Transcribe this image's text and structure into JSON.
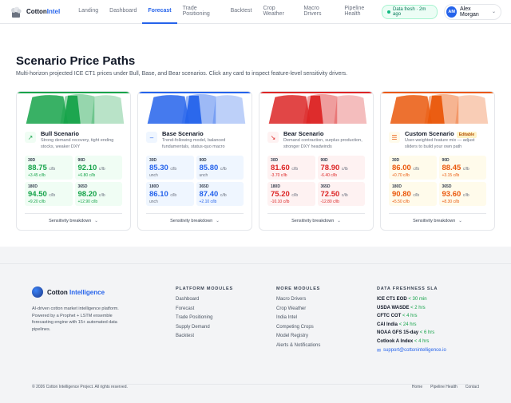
{
  "brand": {
    "name_a": "Cotton",
    "name_b": "Intel"
  },
  "nav": {
    "items": [
      "Landing",
      "Dashboard",
      "Forecast",
      "Trade Positioning",
      "Backtest",
      "Crop Weather",
      "Macro Drivers",
      "Pipeline Health"
    ],
    "active": "Forecast",
    "fresh": "Data fresh · 2m ago",
    "user_initials": "AM",
    "user_name": "Alex Morgan"
  },
  "page": {
    "title": "Scenario Price Paths",
    "subtitle": "Multi-horizon projected ICE CT1 prices under Bull, Base, and Bear scenarios. Click any card to inspect feature-level sensitivity drivers."
  },
  "cards": [
    {
      "title": "Bull Scenario",
      "desc": "Strong demand recovery, tight ending stocks, weaker DXY",
      "icon": "trend-up-icon",
      "glyph": "↗",
      "color": "#16a34a",
      "tint": "#f0fdf4",
      "tag": "",
      "cells": [
        {
          "h": "30D",
          "p": "88.75",
          "u": "c/lb",
          "d": "+3.45 c/lb"
        },
        {
          "h": "90D",
          "p": "92.10",
          "u": "c/lb",
          "d": "+6.80 c/lb"
        },
        {
          "h": "180D",
          "p": "94.50",
          "u": "c/lb",
          "d": "+9.20 c/lb"
        },
        {
          "h": "365D",
          "p": "98.20",
          "u": "c/lb",
          "d": "+12.90 c/lb"
        }
      ],
      "sens": "Sensitivity breakdown"
    },
    {
      "title": "Base Scenario",
      "desc": "Trend-following model, balanced fundamentals, status-quo macro",
      "icon": "minus-icon",
      "glyph": "–",
      "color": "#2563eb",
      "tint": "#eff6ff",
      "tag": "",
      "cells": [
        {
          "h": "30D",
          "p": "85.30",
          "u": "c/lb",
          "d": "unch"
        },
        {
          "h": "90D",
          "p": "85.80",
          "u": "c/lb",
          "d": "unch"
        },
        {
          "h": "180D",
          "p": "86.10",
          "u": "c/lb",
          "d": "unch"
        },
        {
          "h": "365D",
          "p": "87.40",
          "u": "c/lb",
          "d": "+2.10 c/lb"
        }
      ],
      "sens": "Sensitivity breakdown"
    },
    {
      "title": "Bear Scenario",
      "desc": "Demand contraction, surplus production, stronger DXY headwinds",
      "icon": "trend-down-icon",
      "glyph": "↘",
      "color": "#dc2626",
      "tint": "#fef2f2",
      "tag": "",
      "cells": [
        {
          "h": "30D",
          "p": "81.60",
          "u": "c/lb",
          "d": "-3.70 c/lb"
        },
        {
          "h": "90D",
          "p": "78.90",
          "u": "c/lb",
          "d": "-6.40 c/lb"
        },
        {
          "h": "180D",
          "p": "75.20",
          "u": "c/lb",
          "d": "-10.10 c/lb"
        },
        {
          "h": "365D",
          "p": "72.50",
          "u": "c/lb",
          "d": "-12.80 c/lb"
        }
      ],
      "sens": "Sensitivity breakdown"
    },
    {
      "title": "Custom Scenario",
      "desc": "User-weighted feature mix — adjust sliders to build your own path",
      "icon": "sliders-icon",
      "glyph": "☰",
      "color": "#ea580c",
      "tint": "#fffbeb",
      "tag": "Editable",
      "cells": [
        {
          "h": "30D",
          "p": "86.00",
          "u": "c/lb",
          "d": "+0.70 c/lb"
        },
        {
          "h": "90D",
          "p": "88.45",
          "u": "c/lb",
          "d": "+3.15 c/lb"
        },
        {
          "h": "180D",
          "p": "90.80",
          "u": "c/lb",
          "d": "+5.50 c/lb"
        },
        {
          "h": "365D",
          "p": "93.60",
          "u": "c/lb",
          "d": "+8.30 c/lb"
        }
      ],
      "sens": "Sensitivity breakdown"
    }
  ],
  "footer": {
    "brand_a": "Cotton ",
    "brand_b": "Intelligence",
    "desc": "AI-driven cotton market intelligence platform. Powered by a Prophet + LSTM ensemble forecasting engine with 15+ automated data pipelines.",
    "platform_title": "PLATFORM MODULES",
    "platform": [
      "Dashboard",
      "Forecast",
      "Trade Positioning",
      "Supply Demand",
      "Backtest"
    ],
    "more_title": "MORE MODULES",
    "more": [
      "Macro Drivers",
      "Crop Weather",
      "India Intel",
      "Competing Crops",
      "Model Registry",
      "Alerts & Notifications"
    ],
    "sla_title": "DATA FRESHNESS SLA",
    "sla": [
      {
        "k": "ICE CT1 EOD",
        "v": "< 30 min"
      },
      {
        "k": "USDA WASDE",
        "v": "< 2 hrs"
      },
      {
        "k": "CFTC COT",
        "v": "< 4 hrs"
      },
      {
        "k": "CAI India",
        "v": "< 24 hrs"
      },
      {
        "k": "NOAA GFS 15-day",
        "v": "< 6 hrs"
      },
      {
        "k": "Cotlook A Index",
        "v": "< 4 hrs"
      }
    ],
    "email": "support@cottonintelligence.io",
    "copyright": "© 2026 Cotton Intelligence Project. All rights reserved.",
    "bottom_links": [
      "Home",
      "Pipeline Health",
      "Contact"
    ]
  }
}
